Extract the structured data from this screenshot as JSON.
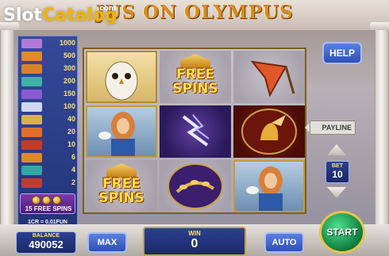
{
  "header": {
    "brand_part1": "Slot",
    "brand_part2": "Catalog",
    "brand_com": ".com",
    "title": "JUS ON OLYMPUS"
  },
  "paytable": {
    "rows": [
      {
        "icon": "owl-purple-icon",
        "value": "1000",
        "color": "#b07ad8"
      },
      {
        "icon": "helmet-orange-icon",
        "value": "500",
        "color": "#e08a2a"
      },
      {
        "icon": "harp-orange-icon",
        "value": "300",
        "color": "#d9822e"
      },
      {
        "icon": "leaf-teal-icon",
        "value": "200",
        "color": "#3fb2a5"
      },
      {
        "icon": "gem-purple-icon",
        "value": "150",
        "color": "#8a5bd0"
      },
      {
        "icon": "bolt-white-icon",
        "value": "100",
        "color": "#cfd8f2"
      },
      {
        "icon": "owl-gold-icon",
        "value": "40",
        "color": "#d9b34a"
      },
      {
        "icon": "feather-orange-icon",
        "value": "20",
        "color": "#e06f2a"
      },
      {
        "icon": "wing-red-icon",
        "value": "10",
        "color": "#c23a2a"
      },
      {
        "icon": "helmet-orange-icon",
        "value": "6",
        "color": "#de8a2a"
      },
      {
        "icon": "laurel-teal-icon",
        "value": "4",
        "color": "#34a7a3"
      },
      {
        "icon": "wing-red-icon",
        "value": "2",
        "color": "#c43b2b"
      }
    ],
    "free_spins_label": "15 FREE SPINS",
    "denomination": "1CR = 0.01FUN"
  },
  "reels": {
    "free_spins_line1": "FREE",
    "free_spins_line2": "SPINS"
  },
  "right_panel": {
    "help_label": "HELP",
    "payline_label": "PAYLINE",
    "bet_label": "BET",
    "bet_value": "10"
  },
  "bottom": {
    "balance_label": "BALANCE",
    "balance_value": "490052",
    "max_label": "MAX",
    "win_label": "WIN",
    "win_value": "0",
    "auto_label": "AUTO",
    "start_label": "START"
  }
}
